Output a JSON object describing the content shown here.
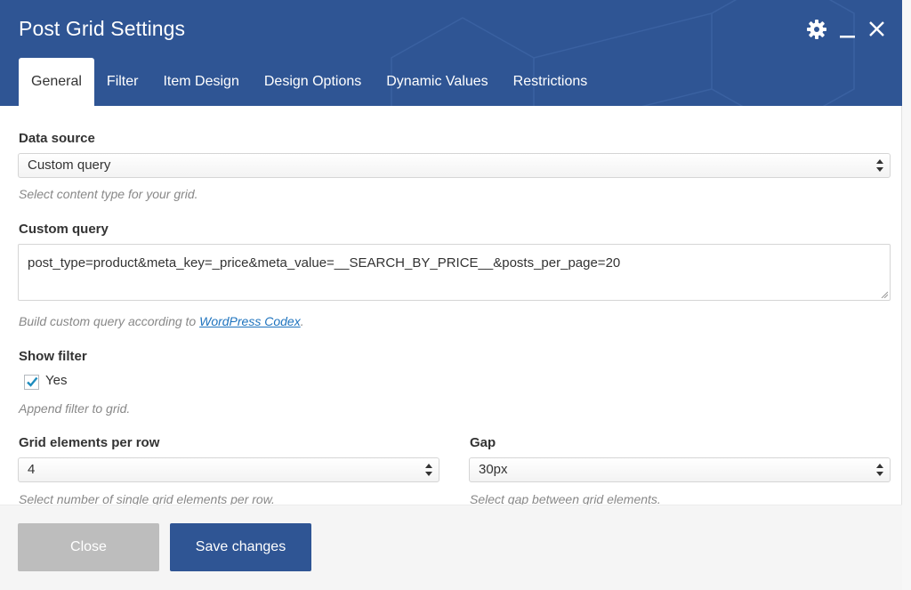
{
  "window": {
    "title": "Post Grid Settings",
    "icons": [
      "gear-icon",
      "minimize-icon",
      "close-icon"
    ]
  },
  "tabs": [
    {
      "label": "General",
      "active": true
    },
    {
      "label": "Filter",
      "active": false
    },
    {
      "label": "Item Design",
      "active": false
    },
    {
      "label": "Design Options",
      "active": false
    },
    {
      "label": "Dynamic Values",
      "active": false
    },
    {
      "label": "Restrictions",
      "active": false
    }
  ],
  "form": {
    "data_source": {
      "label": "Data source",
      "value": "Custom query",
      "help": "Select content type for your grid."
    },
    "custom_query": {
      "label": "Custom query",
      "value": "post_type=product&meta_key=_price&meta_value=__SEARCH_BY_PRICE__&posts_per_page=20",
      "help_prefix": "Build custom query according to ",
      "help_link": "WordPress Codex",
      "help_suffix": "."
    },
    "show_filter": {
      "label": "Show filter",
      "checkbox_label": "Yes",
      "checked": true,
      "help": "Append filter to grid."
    },
    "elements_per_row": {
      "label": "Grid elements per row",
      "value": "4",
      "help": "Select number of single grid elements per row."
    },
    "gap": {
      "label": "Gap",
      "value": "30px",
      "help": "Select gap between grid elements."
    }
  },
  "footer": {
    "close_label": "Close",
    "save_label": "Save changes"
  },
  "colors": {
    "header": "#2f5594",
    "primary_button": "#2f5594",
    "disabled_button": "#bdbdbd",
    "link": "#1e73be",
    "checkmark": "#1e8cbe"
  }
}
